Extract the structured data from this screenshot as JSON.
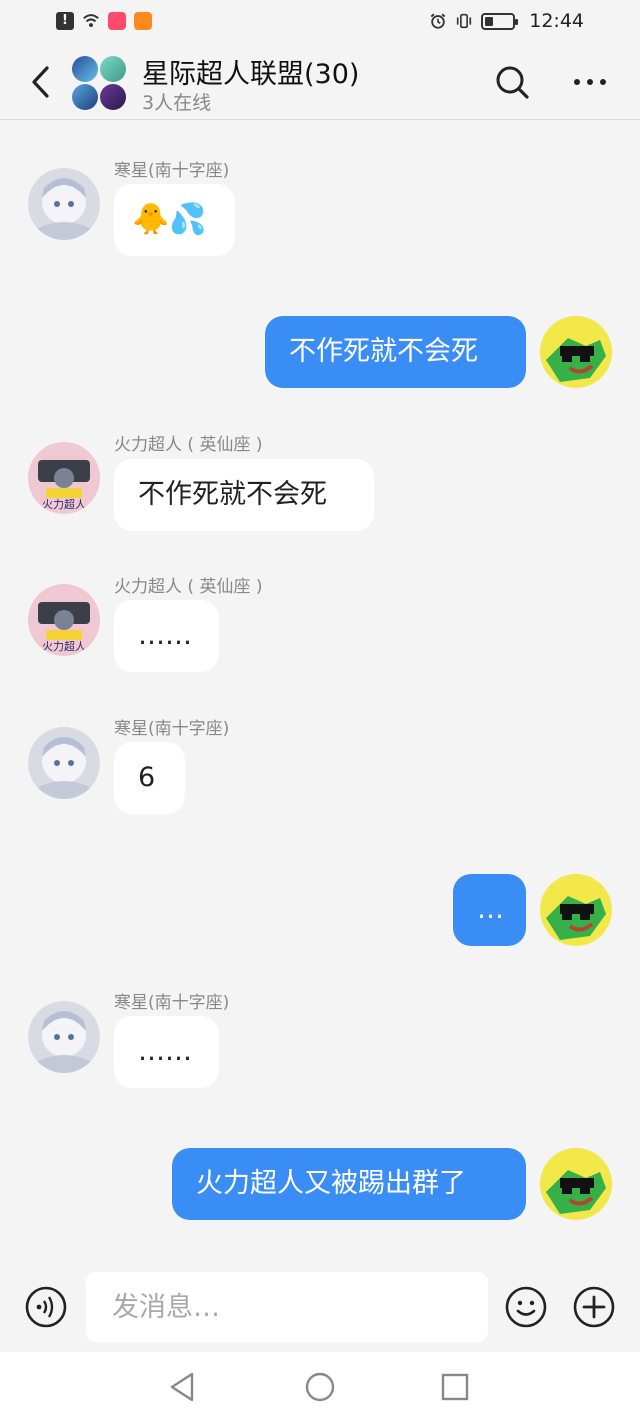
{
  "status_bar": {
    "time": "12:44",
    "left_icons": [
      "alert-icon",
      "wifi-icon",
      "app-icon",
      "app-icon"
    ],
    "right_icons": [
      "alarm-icon",
      "vibrate-icon",
      "battery-icon"
    ],
    "battery_level": 0.3
  },
  "header": {
    "title": "星际超人联盟(30)",
    "subtitle": "3人在线",
    "back_icon": "back-icon",
    "search_icon": "search-icon",
    "more_icon": "more-icon"
  },
  "messages": [
    {
      "side": "in",
      "sender": "寒星(南十字座)",
      "avatar": "hanxing",
      "text": "🐥💦"
    },
    {
      "side": "out",
      "avatar": "me",
      "text": "不作死就不会死"
    },
    {
      "side": "in",
      "sender": "火力超人 ( 英仙座 )",
      "avatar": "huoli",
      "text": "不作死就不会死"
    },
    {
      "side": "in",
      "sender": "火力超人 ( 英仙座 )",
      "avatar": "huoli",
      "text": "……"
    },
    {
      "side": "in",
      "sender": "寒星(南十字座)",
      "avatar": "hanxing",
      "text": "6"
    },
    {
      "side": "out",
      "avatar": "me",
      "text": "…"
    },
    {
      "side": "in",
      "sender": "寒星(南十字座)",
      "avatar": "hanxing",
      "text": "……"
    },
    {
      "side": "out",
      "avatar": "me",
      "text": "火力超人又被踢出群了"
    }
  ],
  "input_bar": {
    "placeholder": "发消息…",
    "voice_icon": "voice-icon",
    "emoji_icon": "emoji-icon",
    "plus_icon": "plus-icon"
  },
  "nav_bar": {
    "icons": [
      "nav-back-icon",
      "nav-home-icon",
      "nav-recents-icon"
    ]
  },
  "colors": {
    "background": "#f4f4f4",
    "outgoing_bubble": "#3a8df5",
    "incoming_bubble": "#ffffff",
    "sender_text": "#888888"
  }
}
